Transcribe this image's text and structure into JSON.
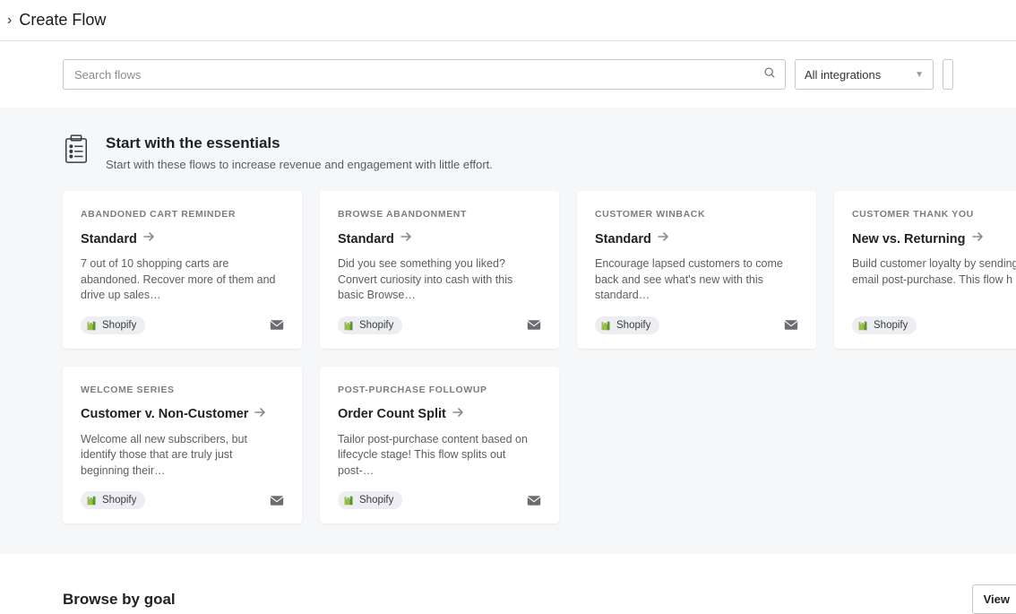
{
  "page": {
    "title": "Create Flow"
  },
  "search": {
    "placeholder": "Search flows"
  },
  "filter": {
    "integrations": "All integrations"
  },
  "essentials": {
    "title": "Start with the essentials",
    "subtitle": "Start with these flows to increase revenue and engagement with little effort.",
    "cards": [
      {
        "eyebrow": "ABANDONED CART REMINDER",
        "title": "Standard",
        "desc": "7 out of 10 shopping carts are abandoned. Recover more of them and drive up sales…",
        "chip": "Shopify"
      },
      {
        "eyebrow": "BROWSE ABANDONMENT",
        "title": "Standard",
        "desc": "Did you see something you liked? Convert curiosity into cash with this basic Browse…",
        "chip": "Shopify"
      },
      {
        "eyebrow": "CUSTOMER WINBACK",
        "title": "Standard",
        "desc": "Encourage lapsed customers to come back and see what's new with this standard…",
        "chip": "Shopify"
      },
      {
        "eyebrow": "CUSTOMER THANK YOU",
        "title": "New vs. Returning",
        "desc": "Build customer loyalty by sending a you email post-purchase. This flow h",
        "chip": "Shopify"
      },
      {
        "eyebrow": "WELCOME SERIES",
        "title": "Customer v. Non-Customer",
        "desc": "Welcome all new subscribers, but identify those that are truly just beginning their…",
        "chip": "Shopify"
      },
      {
        "eyebrow": "POST-PURCHASE FOLLOWUP",
        "title": "Order Count Split",
        "desc": "Tailor post-purchase content based on lifecycle stage! This flow splits out post-…",
        "chip": "Shopify"
      }
    ]
  },
  "goal": {
    "title": "Browse by goal",
    "view": "View"
  }
}
